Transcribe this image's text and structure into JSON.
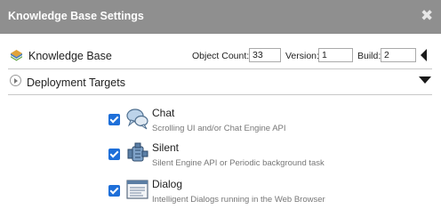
{
  "dialog": {
    "title": "Knowledge Base Settings"
  },
  "kb": {
    "label": "Knowledge Base",
    "object_count_label": "Object Count:",
    "object_count": "33",
    "version_label": "Version:",
    "version": "1",
    "build_label": "Build:",
    "build": "2"
  },
  "deployment": {
    "label": "Deployment Targets",
    "targets": [
      {
        "name": "Chat",
        "description": "Scrolling UI and/or Chat Engine API",
        "checked": true,
        "icon": "chat-bubbles-icon"
      },
      {
        "name": "Silent",
        "description": "Silent Engine API or Periodic background task",
        "checked": true,
        "icon": "engine-icon"
      },
      {
        "name": "Dialog",
        "description": "Intelligent Dialogs running in the Web Browser",
        "checked": true,
        "icon": "browser-window-icon"
      }
    ]
  },
  "colors": {
    "title_bar": "#8f8f8f",
    "checkbox": "#1e6fd9",
    "description_text": "#777777"
  }
}
